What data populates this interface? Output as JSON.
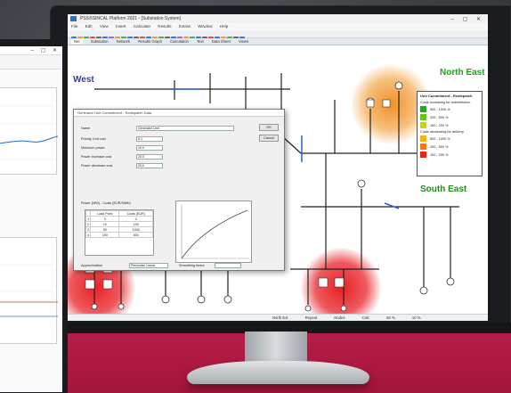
{
  "app": {
    "title": "PSS®SINCAL Platform 2021 - [Substation System]",
    "menu": [
      "File",
      "Edit",
      "View",
      "Insert",
      "Calculate",
      "Results",
      "Extras",
      "Window",
      "Help"
    ],
    "tabs": [
      "Net",
      "Substation",
      "Network",
      "Results Graph",
      "Calculation",
      "Text",
      "Data Sheet",
      "Views"
    ],
    "active_tab": "Net",
    "status": [
      "North Ext",
      "Repeat",
      "Nodes",
      "Calc",
      "60 %",
      "10 %"
    ]
  },
  "regions": {
    "west": "West",
    "north_east": "North East",
    "south_east": "South East"
  },
  "legend": {
    "title": "Unit Commitment - Redispatch",
    "items": [
      "Costs increasing for redistribution",
      "500 - 1000 %",
      "200 - 500 %",
      "100 - 200 %",
      "Costs decreasing for delivery",
      "500 - 1000 %",
      "200 - 500 %",
      "100 - 200 %"
    ],
    "colors": [
      "#1faa1f",
      "#6cc11f",
      "#c7d61d",
      "#e9e01a",
      "#f3b316",
      "#ef7a16",
      "#e2261a"
    ]
  },
  "dialog": {
    "title": "Generator Unit Commitment - Redispatch Data",
    "name_label": "Name",
    "name_value": "Generator Unit",
    "fields": [
      {
        "label": "Priority Unit cost",
        "value": "0.1"
      },
      {
        "label": "Minimum power",
        "value": "10.0"
      },
      {
        "label": "Power increase cost",
        "value": "20.0"
      },
      {
        "label": "Power decrease cost",
        "value": "20.0"
      }
    ],
    "table_title": "Power (MW) - Costs (EUR/MWh)",
    "table_headers": [
      "Load Point",
      "Costs (EUR)"
    ],
    "table_rows": [
      [
        "1",
        "0",
        "0"
      ],
      [
        "2",
        "10",
        "100"
      ],
      [
        "3",
        "50",
        "1000"
      ],
      [
        "4",
        "100",
        "600"
      ]
    ],
    "ok": "OK",
    "cancel": "Cancel",
    "approximation_label": "Approximation",
    "approximation_value": "Piecewise Linear",
    "smoothing_label": "Smoothing factor"
  },
  "colors": {
    "accent_red": "#b81d47",
    "heat_red": "#e8141a",
    "heat_orange": "#f08a1c",
    "region_west": "#2b3fb0",
    "region_north_east": "#16a818",
    "region_south_east": "#1f8f1c"
  },
  "icons": [
    "app-icon",
    "window-controls",
    "toolbar-buttons",
    "legend-swatch"
  ]
}
